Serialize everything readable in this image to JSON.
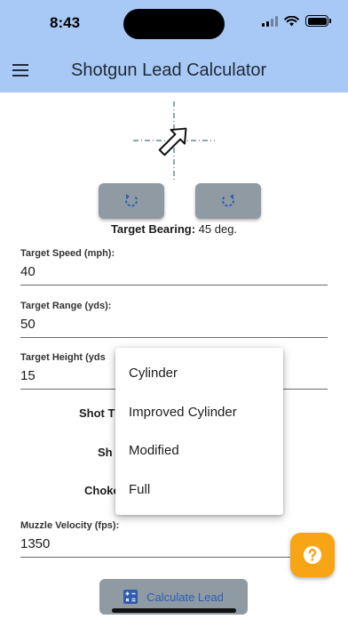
{
  "status_bar": {
    "time": "8:43"
  },
  "app_bar": {
    "title": "Shotgun Lead Calculator"
  },
  "bearing": {
    "label": "Target Bearing:",
    "value": "45 deg."
  },
  "fields": {
    "target_speed": {
      "label": "Target Speed (mph):",
      "value": "40"
    },
    "target_range": {
      "label": "Target Range (yds):",
      "value": "50"
    },
    "target_height": {
      "label": "Target Height (yds",
      "value": "15"
    },
    "muzzle_velocity": {
      "label": "Muzzle Velocity (fps):",
      "value": "1350"
    }
  },
  "row_labels": {
    "shot_type": "Shot T",
    "shot_size": "Sh",
    "choke": "Choke"
  },
  "choke_menu": {
    "options": [
      "Cylinder",
      "Improved Cylinder",
      "Modified",
      "Full"
    ]
  },
  "actions": {
    "calculate_label": "Calculate Lead"
  },
  "colors": {
    "header": "#a8c8f5",
    "button": "#8f9aa3",
    "fab": "#f7a514",
    "accent_text": "#2e5db0"
  },
  "icons": {
    "menu": "menu-icon",
    "bearing_arrow": "arrow-icon",
    "rotate_left": "rotate-ccw-icon",
    "rotate_right": "rotate-cw-icon",
    "calculator": "calculator-icon",
    "help": "help-icon"
  }
}
